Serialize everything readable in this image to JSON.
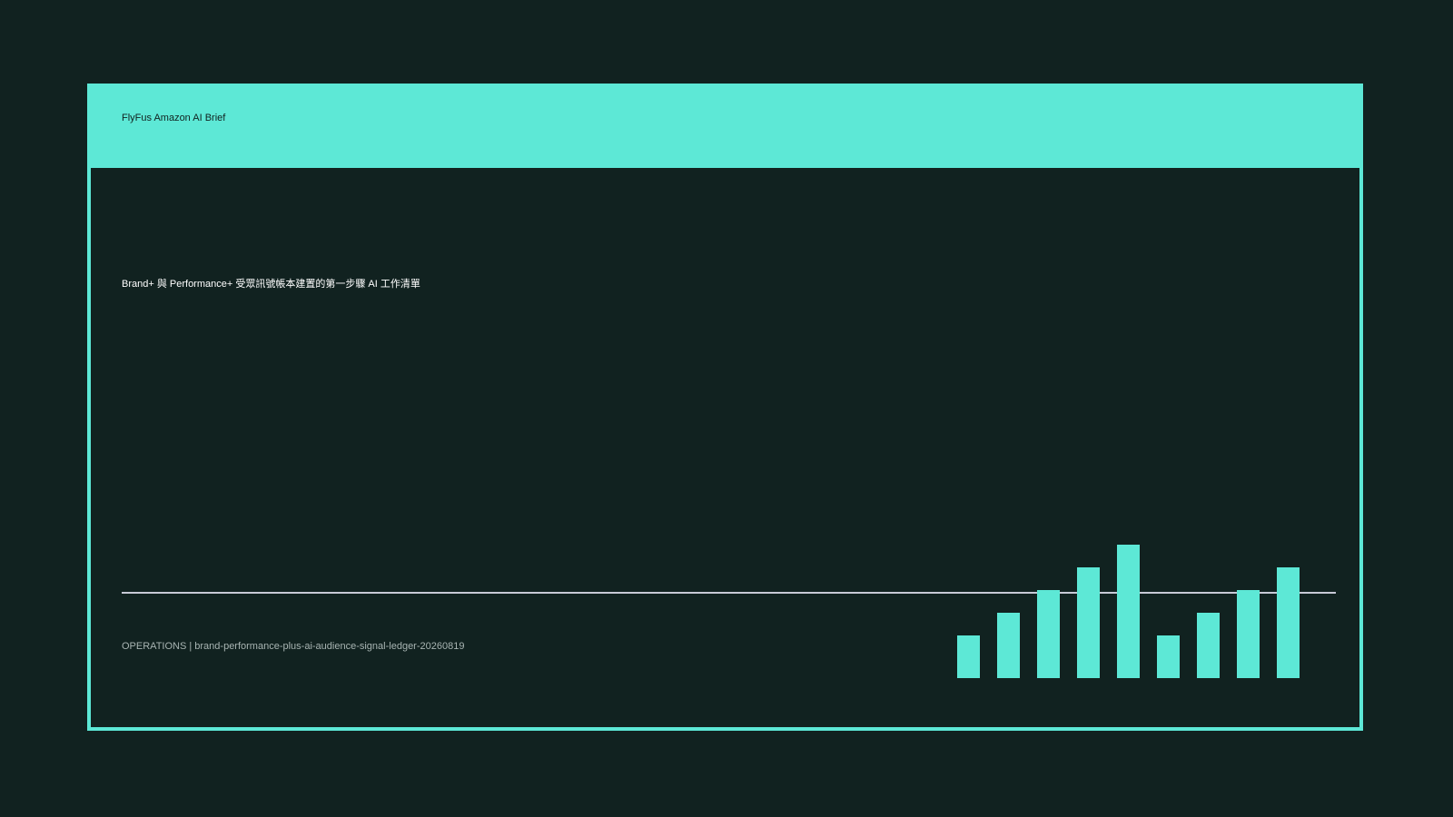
{
  "header": {
    "brand": "FlyFus Amazon AI Brief"
  },
  "main": {
    "headline": "Brand+ 與 Performance+ 受眾訊號帳本建置的第一步驟 AI 工作清單"
  },
  "footer": {
    "text": "OPERATIONS | brand-performance-plus-ai-audience-signal-ledger-20260819"
  },
  "colors": {
    "background": "#112220",
    "accent": "#5de8d6",
    "divider": "#c7c9d6"
  },
  "decor": {
    "bar_levels": [
      0.32,
      0.49,
      0.66,
      0.83,
      1.0,
      0.32,
      0.49,
      0.66,
      0.83
    ]
  }
}
